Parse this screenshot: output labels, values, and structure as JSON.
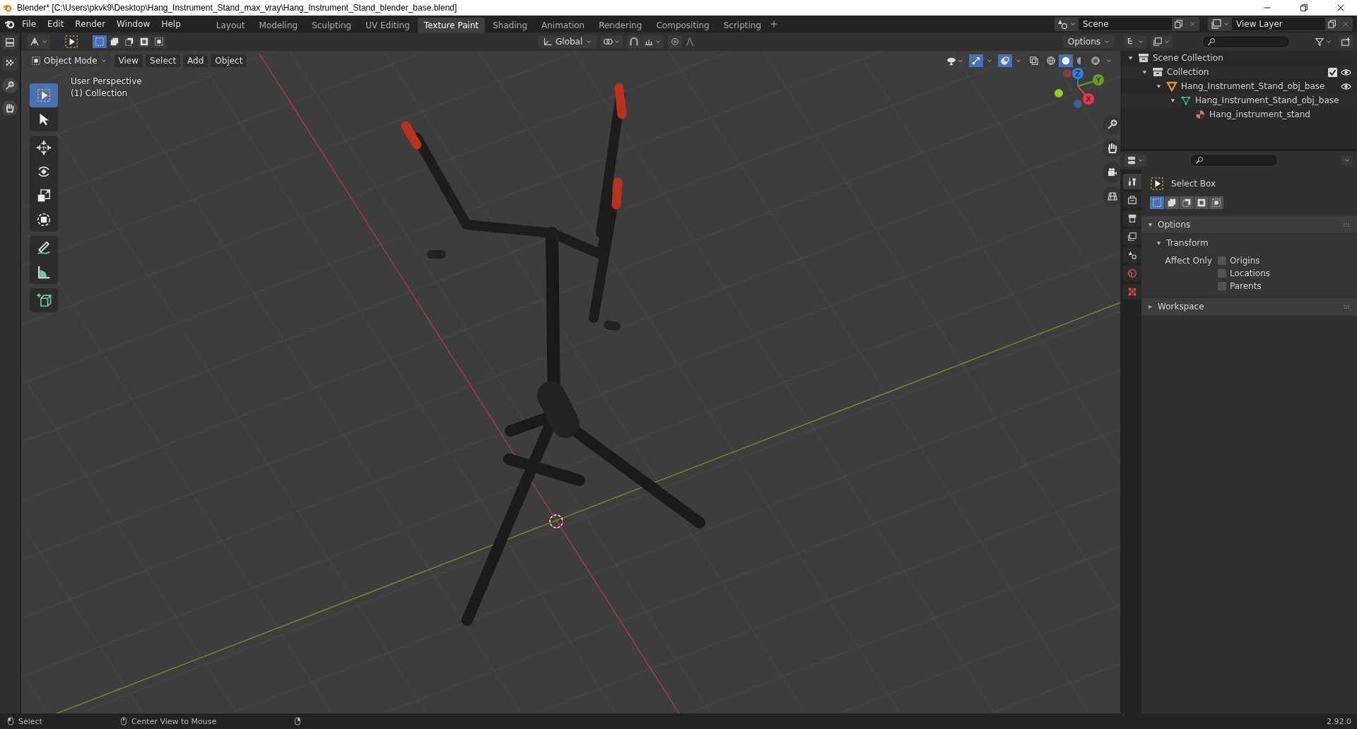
{
  "window": {
    "title": "Blender* [C:\\Users\\pkvk9\\Desktop\\Hang_Instrument_Stand_max_vray\\Hang_Instrument_Stand_blender_base.blend]"
  },
  "menu": [
    "File",
    "Edit",
    "Render",
    "Window",
    "Help"
  ],
  "workspaces": [
    {
      "label": "Layout",
      "selected": false
    },
    {
      "label": "Modeling",
      "selected": false
    },
    {
      "label": "Sculpting",
      "selected": false
    },
    {
      "label": "UV Editing",
      "selected": false
    },
    {
      "label": "Texture Paint",
      "selected": true
    },
    {
      "label": "Shading",
      "selected": false
    },
    {
      "label": "Animation",
      "selected": false
    },
    {
      "label": "Rendering",
      "selected": false
    },
    {
      "label": "Compositing",
      "selected": false
    },
    {
      "label": "Scripting",
      "selected": false
    }
  ],
  "scene": {
    "name": "Scene",
    "view_layer": "View Layer"
  },
  "tool_header": {
    "select_modes": [
      {
        "selected": true
      },
      {
        "selected": false
      },
      {
        "selected": false
      },
      {
        "selected": false
      },
      {
        "selected": false
      }
    ],
    "orientation": "Global",
    "options": "Options"
  },
  "viewport_header": {
    "mode": "Object Mode",
    "menus": [
      "View",
      "Select",
      "Add",
      "Object"
    ],
    "shading": [
      {
        "selected": false
      },
      {
        "selected": true
      },
      {
        "selected": false
      },
      {
        "selected": false
      }
    ]
  },
  "viewport": {
    "view_name": "User Perspective",
    "collection": "(1) Collection",
    "axes": [
      {
        "label": "Z",
        "color": "#2f7fe0"
      },
      {
        "label": "Y",
        "color": "#6a9a22"
      },
      {
        "label": "X",
        "color": "#e8334a"
      }
    ],
    "tools": [
      {
        "kind": "select",
        "selected": true
      },
      {
        "kind": "cursor",
        "selected": false
      },
      {
        "kind": "move",
        "selected": false
      },
      {
        "kind": "rotate",
        "selected": false
      },
      {
        "kind": "scale",
        "selected": false
      },
      {
        "kind": "transform",
        "selected": false
      },
      {
        "kind": "annotate",
        "selected": false
      },
      {
        "kind": "measure",
        "selected": false
      },
      {
        "kind": "add-cube",
        "selected": false
      }
    ]
  },
  "outliner": {
    "tree": [
      {
        "label": "Scene Collection",
        "kind": "scene-collection",
        "expanded": true,
        "checked": false,
        "visible": false,
        "children": [
          {
            "label": "Collection",
            "kind": "collection",
            "expanded": true,
            "checked": true,
            "visible": true,
            "children": [
              {
                "label": "Hang_Instrument_Stand_obj_base",
                "kind": "object",
                "expanded": true,
                "checked": false,
                "visible": true,
                "children": [
                  {
                    "label": "Hang_Instrument_Stand_obj_base",
                    "kind": "mesh",
                    "expanded": true,
                    "checked": false,
                    "visible": false,
                    "children": [
                      {
                        "label": "Hang_instrument_stand",
                        "kind": "material",
                        "expanded": false,
                        "checked": false,
                        "visible": false
                      }
                    ]
                  }
                ]
              }
            ]
          }
        ]
      }
    ]
  },
  "properties": {
    "tabs": [
      {
        "kind": "tool",
        "selected": true
      },
      {
        "kind": "render",
        "selected": false
      },
      {
        "kind": "output",
        "selected": false
      },
      {
        "kind": "view-layer",
        "selected": false
      },
      {
        "kind": "scene",
        "selected": false
      },
      {
        "kind": "world",
        "selected": false
      },
      {
        "kind": "texture",
        "selected": false
      }
    ],
    "tool_name": "Select Box",
    "select_modes": [
      {
        "selected": true
      },
      {
        "selected": false
      },
      {
        "selected": false
      },
      {
        "selected": false
      },
      {
        "selected": false
      }
    ],
    "options": {
      "label": "Options",
      "expanded": true,
      "transform": {
        "label": "Transform",
        "expanded": true,
        "affect_label": "Affect Only",
        "checks": [
          {
            "label": "Origins",
            "checked": false
          },
          {
            "label": "Locations",
            "checked": false
          },
          {
            "label": "Parents",
            "checked": false
          }
        ]
      }
    },
    "workspace": {
      "label": "Workspace",
      "expanded": false
    }
  },
  "status_bar": {
    "hints": [
      {
        "kind": "left-mouse",
        "label": "Select"
      },
      {
        "kind": "middle-mouse",
        "label": "Center View to Mouse"
      },
      {
        "kind": "right-mouse"
      }
    ],
    "version": "2.92.0"
  }
}
